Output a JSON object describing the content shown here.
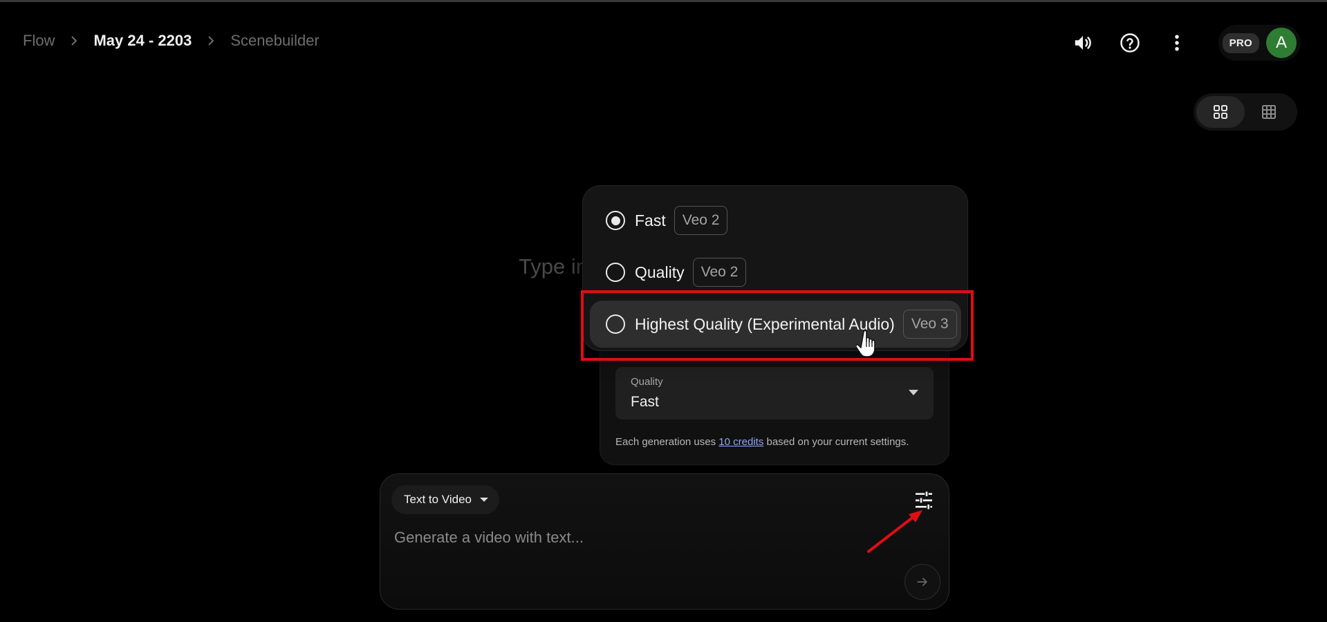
{
  "breadcrumb": {
    "root": "Flow",
    "project": "May 24 - 2203",
    "current": "Scenebuilder"
  },
  "header": {
    "icons": [
      "volume-icon",
      "help-icon",
      "more-vert-icon"
    ],
    "pro_badge": "PRO",
    "avatar_initial": "A",
    "avatar_color": "#2e7d32"
  },
  "view_toggle": {
    "options": [
      "grid-large-icon",
      "grid-small-icon"
    ],
    "active": "grid-large-icon"
  },
  "background_hint": "Type in",
  "model_menu": {
    "options": [
      {
        "label": "Fast",
        "tag": "Veo 2",
        "selected": true
      },
      {
        "label": "Quality",
        "tag": "Veo 2",
        "selected": false
      },
      {
        "label": "Highest Quality (Experimental Audio)",
        "tag": "Veo 3",
        "selected": false,
        "hovered": true
      }
    ]
  },
  "settings": {
    "quality_label": "Quality",
    "quality_value": "Fast",
    "credits_prefix": "Each generation uses ",
    "credits_link": "10 credits",
    "credits_suffix": " based on your current settings."
  },
  "prompt": {
    "mode": "Text to Video",
    "placeholder": "Generate a video with text...",
    "value": ""
  },
  "colors": {
    "highlight": "#e00d15",
    "link": "#8fa6ff",
    "background": "#000000"
  }
}
